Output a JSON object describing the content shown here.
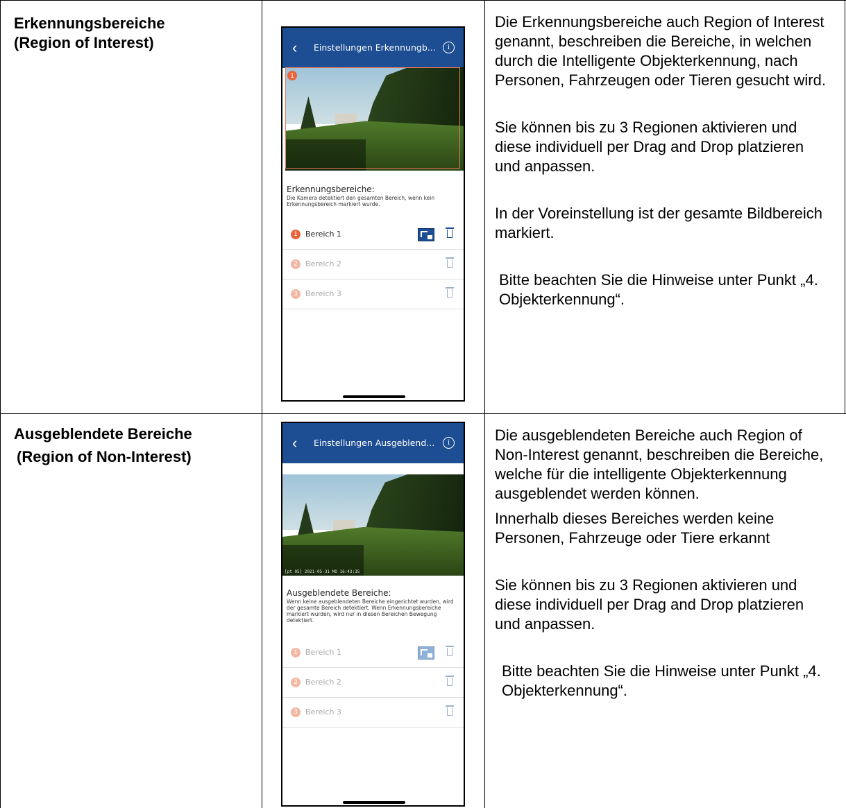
{
  "rows": [
    {
      "title_line1": "Erkennungsbereiche",
      "title_line2": "(Region of Interest)",
      "phone": {
        "nav_title": "Einstellungen Erkennungb...",
        "back_icon": "chevron-left-icon",
        "info_icon": "info-icon",
        "info_glyph": "i",
        "section_title": "Erkennungsbereiche:",
        "section_subtitle": "Die Kamera detektiert den gesamten Bereich, wenn kein Erkennungsbereich markiert wurde.",
        "roi_badge": "1",
        "areas": [
          {
            "number": "1",
            "label": "Bereich 1",
            "active": true
          },
          {
            "number": "2",
            "label": "Bereich 2",
            "active": false
          },
          {
            "number": "3",
            "label": "Bereich 3",
            "active": false
          }
        ]
      },
      "paragraphs": [
        "Die Erkennungsbereiche auch Region of Interest genannt, beschreiben die Bereiche, in welchen durch die Intelligente Objekterkennung, nach Personen, Fahrzeugen oder Tieren gesucht wird.",
        "Sie können bis zu 3 Regionen aktivieren und diese individuell per Drag and Drop platzieren und anpassen.",
        "In der Voreinstellung ist der gesamte Bildbereich markiert.",
        "Bitte beachten Sie die Hinweise unter Punkt „4. Objekterkennung“."
      ]
    },
    {
      "title_line1": "Ausgeblendete Bereiche",
      "title_line2": "(Region of Non-Interest)",
      "phone": {
        "nav_title": "Einstellungen Ausgeblend...",
        "back_icon": "chevron-left-icon",
        "info_icon": "info-icon",
        "info_glyph": "i",
        "timestamp": "[pt 05] 2021-05-31 MO 16:43:35",
        "section_title": "Ausgeblendete Bereiche:",
        "section_subtitle": "Wenn keine ausgeblendeten Bereiche eingerichtet wurden, wird der gesamte Bereich detektiert. Wenn Erkennungsbereiche markiert wurden, wird nur in diesen Bereichen Bewegung detektiert.",
        "areas": [
          {
            "number": "1",
            "label": "Bereich 1",
            "active": false
          },
          {
            "number": "2",
            "label": "Bereich 2",
            "active": false
          },
          {
            "number": "3",
            "label": "Bereich 3",
            "active": false
          }
        ]
      },
      "paragraphs": [
        "Die ausgeblendeten Bereiche auch Region of Non-Interest genannt, beschreiben die Bereiche, welche für die intelligente Objekterkennung ausgeblendet werden können.",
        "Innerhalb dieses Bereiches werden keine Personen, Fahrzeuge oder Tiere erkannt",
        "Sie können bis zu 3 Regionen aktivieren und diese individuell per Drag and Drop platzieren und anpassen.",
        "Bitte beachten Sie die Hinweise unter Punkt „4. Objekterkennung“."
      ]
    }
  ],
  "colors": {
    "nav_blue": "#1d4d92",
    "active_badge": "#e8643c",
    "inactive_badge": "#f3b8a4",
    "active_trash": "#1d4d92",
    "inactive_trash": "#9ab0d0",
    "inactive_text": "#a8a8a8"
  }
}
